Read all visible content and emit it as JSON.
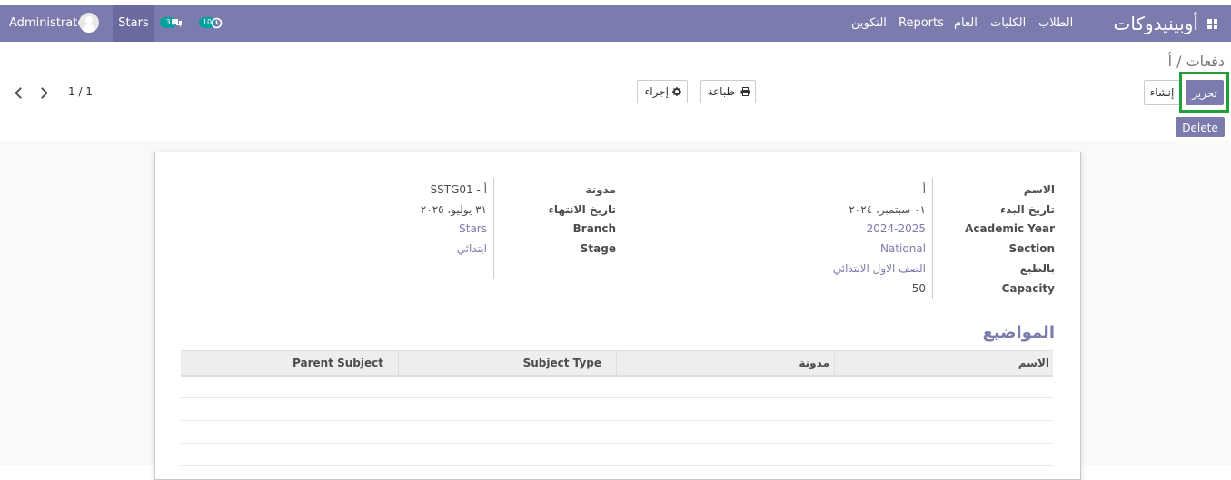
{
  "navbar": {
    "brand": "أوبينيدوكات",
    "menu": [
      "الطلاب",
      "الكليات",
      "العام",
      "Reports",
      "التكوين"
    ],
    "stars": "Stars",
    "messages_count": "3",
    "activities_count": "10",
    "user": "Administrator"
  },
  "control_panel": {
    "breadcrumb": "دفعات / أ",
    "edit_label": "تحرير",
    "create_label": "إنشاء",
    "print_label": "طباعة",
    "action_label": "إجراء",
    "pager": "1 / 1",
    "delete_label": "Delete"
  },
  "form": {
    "right": [
      {
        "label": "الاسم",
        "value": "أ"
      },
      {
        "label": "تاريخ البدء",
        "value": "٠١ سبتمبر، ٢٠٢٤"
      },
      {
        "label": "Academic Year",
        "value": "2024-2025"
      },
      {
        "label": "Section",
        "value": "National"
      },
      {
        "label": "بالطبع",
        "value": "الصف الاول الابتدائي"
      },
      {
        "label": "Capacity",
        "value": "50"
      }
    ],
    "left": [
      {
        "label": "مدونة",
        "value": "SSTG01 - أ"
      },
      {
        "label": "تاريخ الانتهاء",
        "value": "٣١ يوليو، ٢٠٢٥"
      },
      {
        "label": "Branch",
        "value": "Stars"
      },
      {
        "label": "Stage",
        "value": "ابتدائي"
      }
    ],
    "subjects_title": "المواضيع",
    "subjects_columns": [
      "الاسم",
      "مدونة",
      "Subject Type",
      "Parent Subject"
    ]
  },
  "colors": {
    "brand": "#7c7bad",
    "badge": "#00a09d",
    "highlight": "#21a039"
  }
}
